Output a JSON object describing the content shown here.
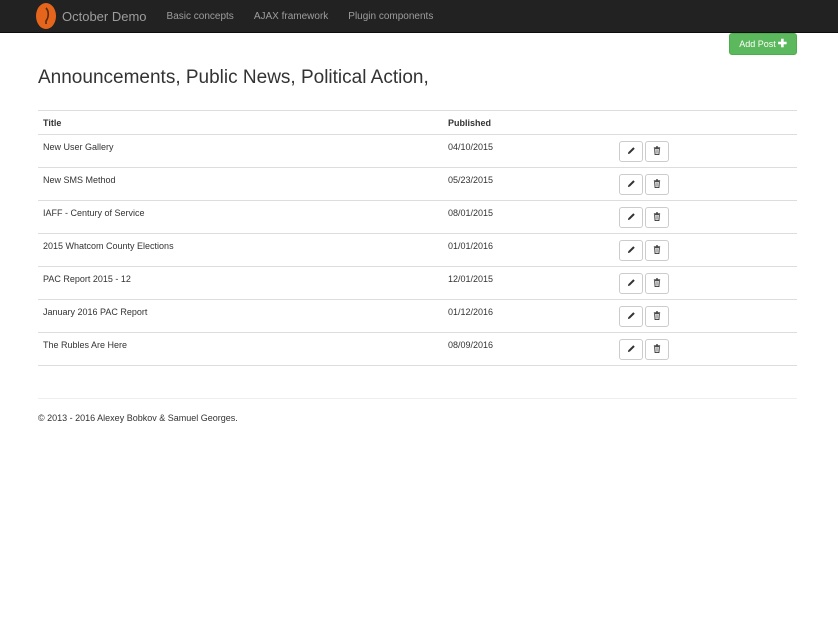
{
  "navbar": {
    "brand": "October Demo",
    "links": [
      "Basic concepts",
      "AJAX framework",
      "Plugin components"
    ]
  },
  "page": {
    "add_button": "Add Post",
    "title": "Announcements, Public News, Political Action,"
  },
  "table": {
    "headers": {
      "title": "Title",
      "published": "Published"
    },
    "rows": [
      {
        "title": "New User Gallery",
        "published": "04/10/2015"
      },
      {
        "title": "New SMS Method",
        "published": "05/23/2015"
      },
      {
        "title": "IAFF - Century of Service",
        "published": "08/01/2015"
      },
      {
        "title": "2015 Whatcom County Elections",
        "published": "01/01/2016"
      },
      {
        "title": "PAC Report 2015 - 12",
        "published": "12/01/2015"
      },
      {
        "title": "January 2016 PAC Report",
        "published": "01/12/2016"
      },
      {
        "title": "The Rubles Are Here",
        "published": "08/09/2016"
      }
    ]
  },
  "footer": {
    "text": "© 2013 - 2016 Alexey Bobkov & Samuel Georges."
  },
  "colors": {
    "navbar": "#222222",
    "logo": "#e5651c",
    "success": "#5cb85c"
  },
  "icons": {
    "logo": "october-logo-icon",
    "add": "plus-icon",
    "edit": "pencil-icon",
    "delete": "trash-icon"
  }
}
